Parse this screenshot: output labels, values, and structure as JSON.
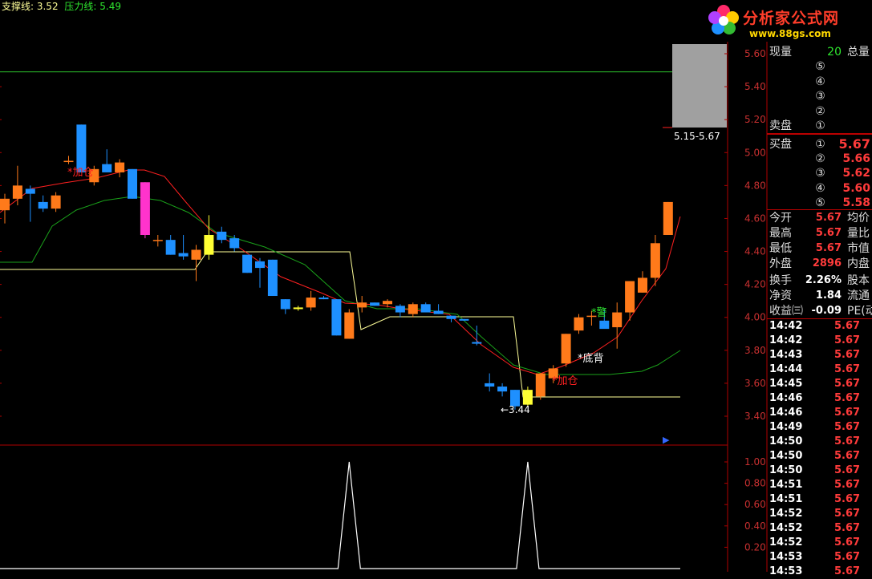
{
  "header": {
    "support_label": "支撑线: 3.52",
    "resistance_label": "压力线: 5.49"
  },
  "logo": {
    "title": "分析家公式网",
    "url": "www.88gs.com"
  },
  "main_axis": {
    "ticks": [
      "5.60",
      "5.40",
      "5.20",
      "5.00",
      "4.80",
      "4.60",
      "4.40",
      "4.20",
      "4.00",
      "3.80",
      "3.60",
      "3.40"
    ]
  },
  "sub_axis": {
    "ticks": [
      "1.00",
      "0.80",
      "0.60",
      "0.40",
      "0.20"
    ]
  },
  "annotations": {
    "range_box": "5.15-5.67",
    "low_marker": "←3.44",
    "add_pos_1": "*加仓",
    "add_pos_2": "*加仓",
    "warning": "*警",
    "bottom_div": "*底背"
  },
  "panel": {
    "current_vol_label": "现量",
    "current_vol": "20",
    "total_vol_label": "总量",
    "sell_label": "卖盘",
    "buy_label": "买盘",
    "sell_levels": [
      "⑤",
      "④",
      "③",
      "②",
      "①"
    ],
    "buy_levels": [
      {
        "idx": "①",
        "price": "5.67"
      },
      {
        "idx": "②",
        "price": "5.66"
      },
      {
        "idx": "③",
        "price": "5.62"
      },
      {
        "idx": "④",
        "price": "5.60"
      },
      {
        "idx": "⑤",
        "price": "5.58"
      }
    ],
    "stats": [
      {
        "label": "今开",
        "value": "5.67",
        "label2": "均价",
        "color": "red"
      },
      {
        "label": "最高",
        "value": "5.67",
        "label2": "量比",
        "color": "red"
      },
      {
        "label": "最低",
        "value": "5.67",
        "label2": "市值",
        "color": "red"
      },
      {
        "label": "外盘",
        "value": "2896",
        "label2": "内盘",
        "color": "red"
      },
      {
        "label": "换手",
        "value": "2.26%",
        "label2": "股本",
        "color": "white"
      },
      {
        "label": "净资",
        "value": "1.84",
        "label2": "流通",
        "color": "white"
      },
      {
        "label": "收益㈢",
        "value": "-0.09",
        "label2": "PE(动",
        "color": "white"
      }
    ],
    "ticks": [
      {
        "time": "14:42",
        "price": "5.67"
      },
      {
        "time": "14:42",
        "price": "5.67"
      },
      {
        "time": "14:43",
        "price": "5.67"
      },
      {
        "time": "14:44",
        "price": "5.67"
      },
      {
        "time": "14:45",
        "price": "5.67"
      },
      {
        "time": "14:46",
        "price": "5.67"
      },
      {
        "time": "14:46",
        "price": "5.67"
      },
      {
        "time": "14:49",
        "price": "5.67"
      },
      {
        "time": "14:50",
        "price": "5.67"
      },
      {
        "time": "14:50",
        "price": "5.67"
      },
      {
        "time": "14:50",
        "price": "5.67"
      },
      {
        "time": "14:51",
        "price": "5.67"
      },
      {
        "time": "14:51",
        "price": "5.67"
      },
      {
        "time": "14:52",
        "price": "5.67"
      },
      {
        "time": "14:52",
        "price": "5.67"
      },
      {
        "time": "14:52",
        "price": "5.67"
      },
      {
        "time": "14:53",
        "price": "5.67"
      },
      {
        "time": "14:53",
        "price": "5.67"
      }
    ]
  },
  "colors": {
    "up_candle": "#ff7a1a",
    "down_candle": "#1e90ff",
    "signal_candle": "#ffff33",
    "ma_red": "#ff2020",
    "ma_green": "#1aa01a",
    "support_line": "#ffff99",
    "resistance_line": "#2ec82e",
    "axis": "#b00000"
  },
  "chart_data": [
    {
      "type": "candlestick",
      "ylim": [
        3.3,
        5.67
      ],
      "lines": {
        "support": 3.52,
        "resistance": 5.49
      },
      "candles": [
        {
          "o": 4.65,
          "h": 4.75,
          "l": 4.57,
          "c": 4.72
        },
        {
          "o": 4.72,
          "h": 4.92,
          "l": 4.68,
          "c": 4.8
        },
        {
          "o": 4.78,
          "h": 4.8,
          "l": 4.58,
          "c": 4.75
        },
        {
          "o": 4.7,
          "h": 4.74,
          "l": 4.64,
          "c": 4.66
        },
        {
          "o": 4.66,
          "h": 4.76,
          "l": 4.64,
          "c": 4.74
        },
        {
          "o": 4.95,
          "h": 4.98,
          "l": 4.93,
          "c": 4.95
        },
        {
          "o": 5.17,
          "h": 5.17,
          "l": 4.88,
          "c": 4.88
        },
        {
          "o": 4.82,
          "h": 4.92,
          "l": 4.8,
          "c": 4.9
        },
        {
          "o": 4.93,
          "h": 5.02,
          "l": 4.88,
          "c": 4.88
        },
        {
          "o": 4.88,
          "h": 4.96,
          "l": 4.85,
          "c": 4.94
        },
        {
          "o": 4.9,
          "h": 4.9,
          "l": 4.72,
          "c": 4.72
        },
        {
          "o": 4.82,
          "h": 4.82,
          "l": 4.48,
          "c": 4.5
        },
        {
          "o": 4.47,
          "h": 4.5,
          "l": 4.43,
          "c": 4.47
        },
        {
          "o": 4.47,
          "h": 4.5,
          "l": 4.38,
          "c": 4.38
        },
        {
          "o": 4.39,
          "h": 4.5,
          "l": 4.35,
          "c": 4.37
        },
        {
          "o": 4.35,
          "h": 4.44,
          "l": 4.22,
          "c": 4.41
        },
        {
          "o": 4.38,
          "h": 4.62,
          "l": 4.35,
          "c": 4.5
        },
        {
          "o": 4.52,
          "h": 4.55,
          "l": 4.45,
          "c": 4.47
        },
        {
          "o": 4.48,
          "h": 4.5,
          "l": 4.4,
          "c": 4.42
        },
        {
          "o": 4.38,
          "h": 4.38,
          "l": 4.27,
          "c": 4.27
        },
        {
          "o": 4.34,
          "h": 4.36,
          "l": 4.18,
          "c": 4.3
        },
        {
          "o": 4.35,
          "h": 4.35,
          "l": 4.13,
          "c": 4.13
        },
        {
          "o": 4.11,
          "h": 4.11,
          "l": 4.02,
          "c": 4.05
        },
        {
          "o": 4.05,
          "h": 4.07,
          "l": 4.04,
          "c": 4.06
        },
        {
          "o": 4.06,
          "h": 4.16,
          "l": 4.04,
          "c": 4.12
        },
        {
          "o": 4.12,
          "h": 4.13,
          "l": 4.11,
          "c": 4.11
        },
        {
          "o": 4.11,
          "h": 4.11,
          "l": 3.89,
          "c": 3.89
        },
        {
          "o": 3.87,
          "h": 4.05,
          "l": 3.87,
          "c": 4.03
        },
        {
          "o": 4.06,
          "h": 4.13,
          "l": 4.03,
          "c": 4.09
        },
        {
          "o": 4.09,
          "h": 4.09,
          "l": 4.07,
          "c": 4.07
        },
        {
          "o": 4.08,
          "h": 4.11,
          "l": 4.06,
          "c": 4.1
        },
        {
          "o": 4.07,
          "h": 4.08,
          "l": 4.0,
          "c": 4.03
        },
        {
          "o": 4.02,
          "h": 4.09,
          "l": 4.0,
          "c": 4.08
        },
        {
          "o": 4.08,
          "h": 4.09,
          "l": 4.05,
          "c": 4.03
        },
        {
          "o": 4.04,
          "h": 4.08,
          "l": 4.02,
          "c": 4.02
        },
        {
          "o": 4.01,
          "h": 4.01,
          "l": 3.97,
          "c": 3.99
        },
        {
          "o": 3.99,
          "h": 3.99,
          "l": 3.98,
          "c": 3.98
        },
        {
          "o": 3.85,
          "h": 3.95,
          "l": 3.83,
          "c": 3.84
        },
        {
          "o": 3.6,
          "h": 3.66,
          "l": 3.55,
          "c": 3.58
        },
        {
          "o": 3.58,
          "h": 3.6,
          "l": 3.52,
          "c": 3.55
        },
        {
          "o": 3.56,
          "h": 3.56,
          "l": 3.44,
          "c": 3.46
        },
        {
          "o": 3.47,
          "h": 3.58,
          "l": 3.46,
          "c": 3.56
        },
        {
          "o": 3.52,
          "h": 3.66,
          "l": 3.5,
          "c": 3.66
        },
        {
          "o": 3.63,
          "h": 3.71,
          "l": 3.6,
          "c": 3.69
        },
        {
          "o": 3.72,
          "h": 3.9,
          "l": 3.7,
          "c": 3.9
        },
        {
          "o": 3.92,
          "h": 4.02,
          "l": 3.9,
          "c": 4.0
        },
        {
          "o": 4.01,
          "h": 4.04,
          "l": 3.95,
          "c": 4.01
        },
        {
          "o": 3.98,
          "h": 4.05,
          "l": 3.94,
          "c": 3.93
        },
        {
          "o": 3.94,
          "h": 4.09,
          "l": 3.81,
          "c": 4.03
        },
        {
          "o": 4.03,
          "h": 4.22,
          "l": 3.98,
          "c": 4.22
        },
        {
          "o": 4.15,
          "h": 4.28,
          "l": 4.15,
          "c": 4.24
        },
        {
          "o": 4.24,
          "h": 4.5,
          "l": 4.19,
          "c": 4.45
        },
        {
          "o": 4.5,
          "h": 4.7,
          "l": 4.5,
          "c": 4.7
        }
      ]
    },
    {
      "type": "line",
      "ylim": [
        0,
        1.1
      ],
      "ticks": [
        1.0,
        0.8,
        0.6,
        0.4,
        0.2
      ],
      "spikes_at_candles": [
        27,
        41
      ]
    }
  ]
}
